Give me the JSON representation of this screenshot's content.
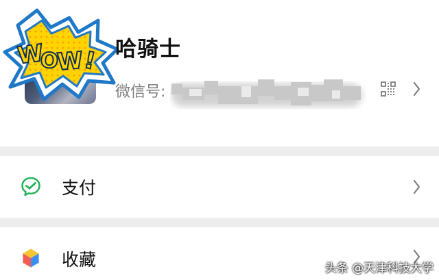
{
  "profile": {
    "name": "哈骑士",
    "wechat_id_label": "微信号:",
    "sticker_text": "WOW!"
  },
  "menu": {
    "items": [
      {
        "label": "支付",
        "icon": "wechat-pay-icon"
      },
      {
        "label": "收藏",
        "icon": "favorites-cube-icon"
      }
    ]
  },
  "watermark": "头条 @天津科技大学",
  "colors": {
    "background": "#ffffff",
    "section_gap": "#ededed",
    "primary_text": "#111111",
    "secondary_text": "#7f7f7f",
    "pay_green": "#22b35a",
    "sticker_blue": "#1f78c8",
    "sticker_yellow": "#ffd400",
    "sticker_orange": "#ff8f00"
  }
}
